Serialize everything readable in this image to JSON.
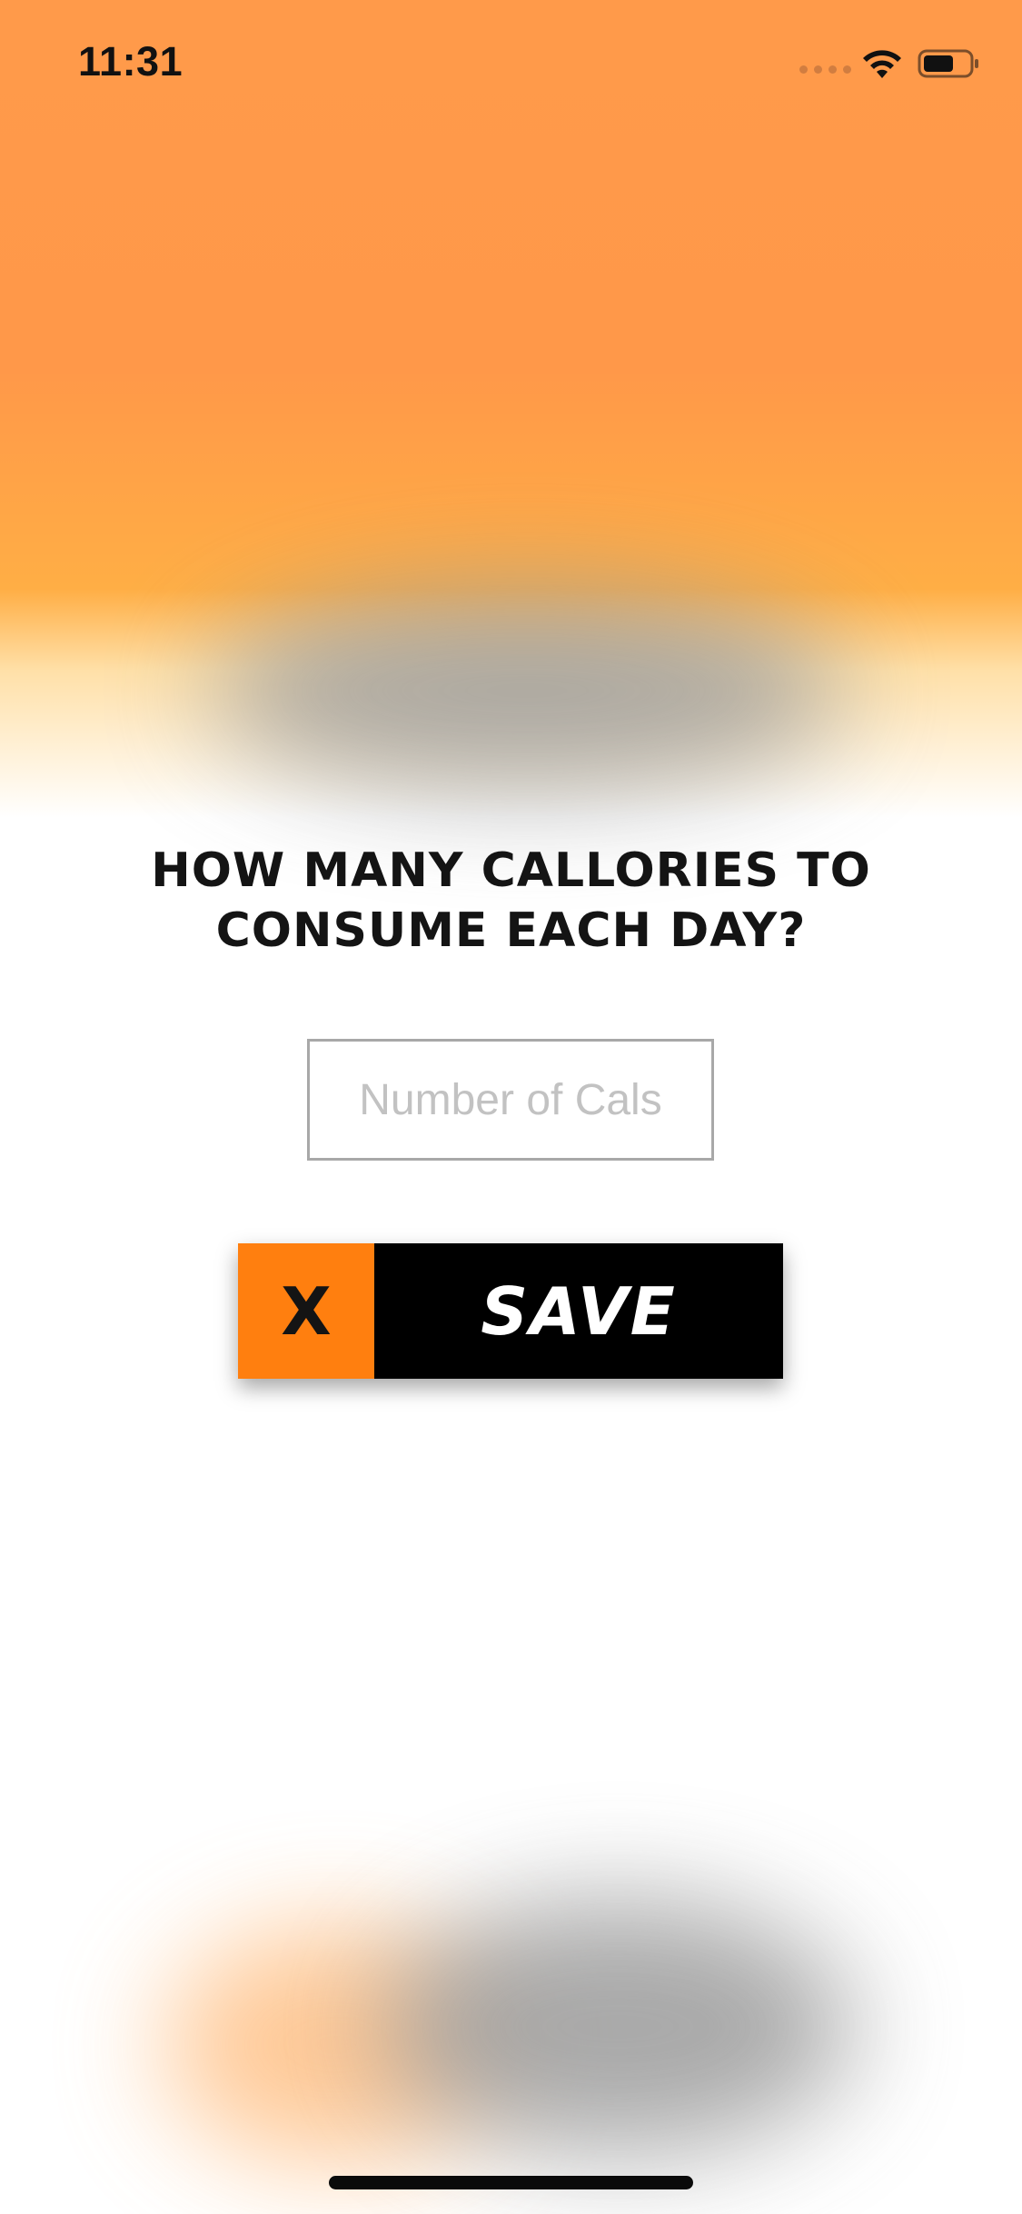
{
  "status_bar": {
    "time": "11:31",
    "wifi_icon": "wifi-icon",
    "battery_icon": "battery-icon",
    "signal_icon": "cellular-signal-icon"
  },
  "content": {
    "question": "HOW MANY CALLORIES TO CONSUME EACH DAY?",
    "calories_input": {
      "value": "",
      "placeholder": "Number of Cals"
    }
  },
  "actions": {
    "close_label": "X",
    "save_label": "SAVE"
  },
  "colors": {
    "accent_orange": "#ff7f0f",
    "background_orange": "#ff9849",
    "save_background": "#000000"
  }
}
